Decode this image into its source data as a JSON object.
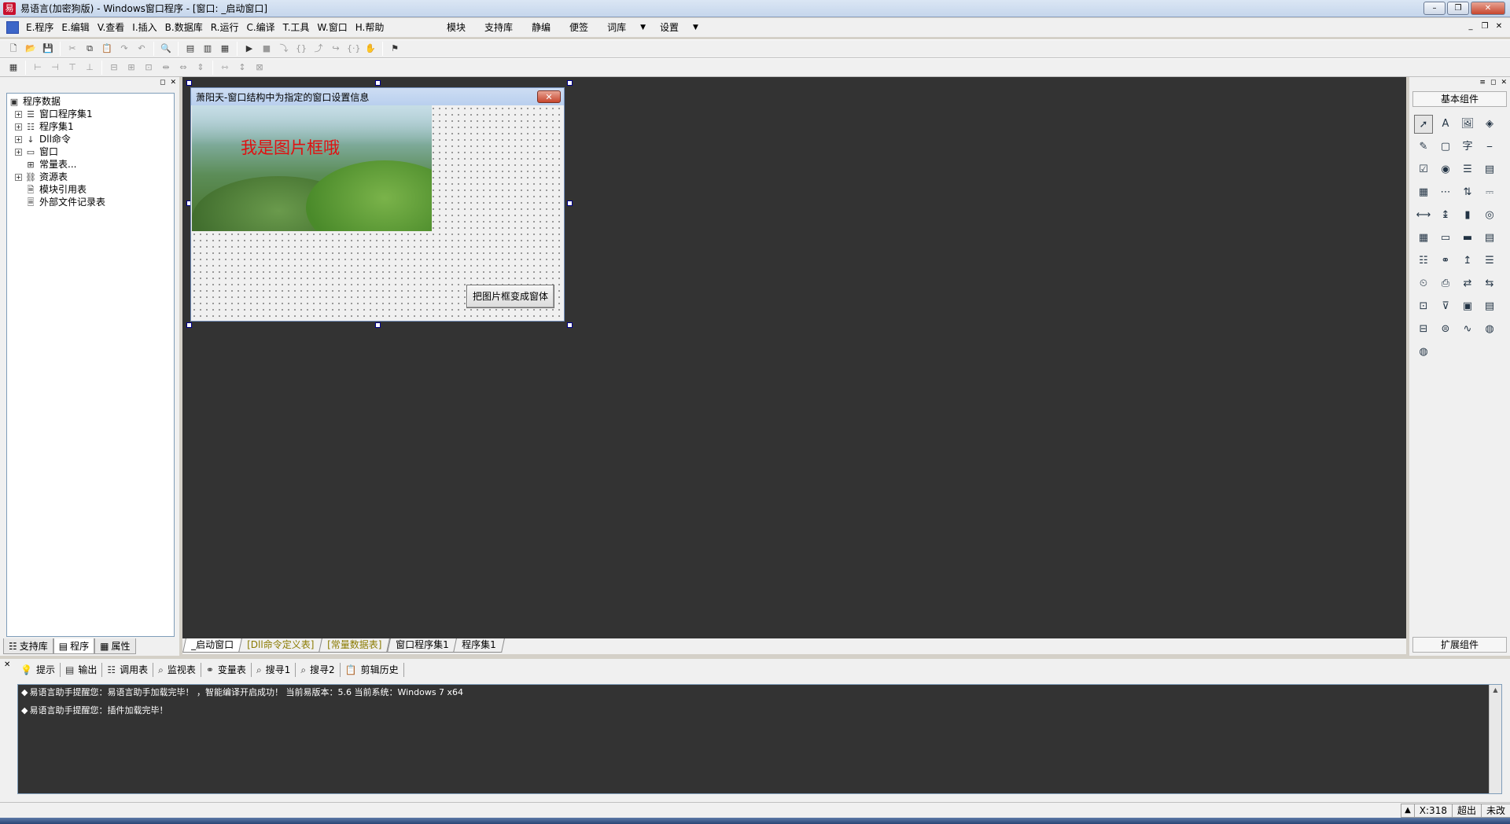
{
  "title": {
    "text": "易语言(加密狗版) - Windows窗口程序 - [窗口: _启动窗口]",
    "controls": {
      "minimize": "–",
      "restore": "❐",
      "close": "✕"
    }
  },
  "menu": {
    "items": [
      "E.程序",
      "E.编辑",
      "V.查看",
      "I.插入",
      "B.数据库",
      "R.运行",
      "C.编译",
      "T.工具",
      "W.窗口",
      "H.帮助"
    ],
    "right_items": [
      "模块",
      "支持库",
      "静编",
      "便签",
      "词库",
      "设置"
    ],
    "mdi_controls": {
      "minimize": "_",
      "restore": "❐",
      "close": "✕"
    }
  },
  "left_panel": {
    "tree": [
      {
        "label": "程序数据",
        "level": 0,
        "expander": "",
        "icon": "program-data-icon"
      },
      {
        "label": "窗口程序集1",
        "level": 1,
        "expander": "+",
        "icon": "window-assembly-icon"
      },
      {
        "label": "程序集1",
        "level": 1,
        "expander": "+",
        "icon": "assembly-icon"
      },
      {
        "label": "Dll命令",
        "level": 1,
        "expander": "+",
        "icon": "dll-icon"
      },
      {
        "label": "窗口",
        "level": 1,
        "expander": "+",
        "icon": "window-icon"
      },
      {
        "label": "常量表...",
        "level": 1,
        "expander": "",
        "icon": "constant-icon"
      },
      {
        "label": "资源表",
        "level": 1,
        "expander": "+",
        "icon": "resource-icon"
      },
      {
        "label": "模块引用表",
        "level": 1,
        "expander": "",
        "icon": "module-ref-icon"
      },
      {
        "label": "外部文件记录表",
        "level": 1,
        "expander": "",
        "icon": "external-file-icon"
      }
    ],
    "tabs": [
      "支持库",
      "程序",
      "属性"
    ]
  },
  "designer": {
    "form_title": "萧阳天-窗口结构中为指定的窗口设置信息",
    "picture_text": "我是图片框哦",
    "button_label": "把图片框变成窗体"
  },
  "doc_tabs": [
    {
      "label": "_启动窗口",
      "style": "active"
    },
    {
      "label": "[Dll命令定义表]",
      "style": "yellow"
    },
    {
      "label": "[常量数据表]",
      "style": "yellow"
    },
    {
      "label": "窗口程序集1",
      "style": "normal"
    },
    {
      "label": "程序集1",
      "style": "normal"
    }
  ],
  "components": {
    "header": "基本组件",
    "footer": "扩展组件",
    "items": [
      "pointer-icon",
      "label-icon",
      "picture-box-icon",
      "shape-icon",
      "edit-icon",
      "groupbox-icon",
      "text-icon",
      "line-icon",
      "checkbox-icon",
      "radio-icon",
      "listbox-icon",
      "combobox-icon",
      "grid-icon",
      "ruler-icon",
      "scroll-icon",
      "slider-icon",
      "hscroll-icon",
      "vscroll-icon",
      "progress-icon",
      "camera-icon",
      "calendar-icon",
      "frame-icon",
      "folder-icon",
      "file-icon",
      "table-icon",
      "network-icon",
      "chart-icon",
      "list-icon",
      "timer-icon",
      "printer-icon",
      "client-icon",
      "server-icon",
      "data-source-icon",
      "filter-icon",
      "panel-icon",
      "report-icon",
      "db-table-icon",
      "db-link-icon",
      "curve-icon",
      "odbc-icon",
      "odbc-db-icon"
    ]
  },
  "output": {
    "tabs": [
      "提示",
      "输出",
      "调用表",
      "监视表",
      "变量表",
      "搜寻1",
      "搜寻2",
      "剪辑历史"
    ],
    "lines": [
      "易语言助手提醒您：易语言助手加载完毕！ ，智能编译开启成功！ 当前易版本：5.6  当前系统：Windows 7 x64",
      "易语言助手提醒您：插件加载完毕！"
    ]
  },
  "status": {
    "coord": "X:318",
    "mode": "超出",
    "modified": "未改"
  }
}
